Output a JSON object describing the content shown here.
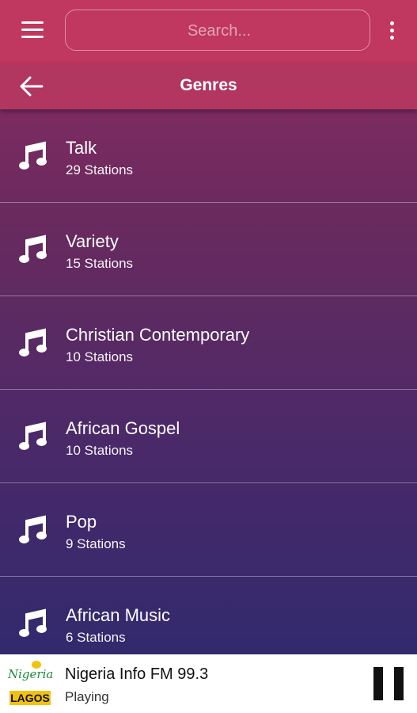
{
  "header": {
    "search_placeholder": "Search...",
    "title": "Genres",
    "menu_icon": "hamburger-menu-icon",
    "more_icon": "more-vertical-icon",
    "back_icon": "arrow-left-icon",
    "bar_color": "#c0375f"
  },
  "genres": [
    {
      "name": "Talk",
      "count": "29 Stations",
      "icon": "music-note-icon"
    },
    {
      "name": "Variety",
      "count": "15 Stations",
      "icon": "music-note-icon"
    },
    {
      "name": "Christian Contemporary",
      "count": "10 Stations",
      "icon": "music-note-icon"
    },
    {
      "name": "African Gospel",
      "count": "10 Stations",
      "icon": "music-note-icon"
    },
    {
      "name": "Pop",
      "count": "9 Stations",
      "icon": "music-note-icon"
    },
    {
      "name": "African Music",
      "count": "6 Stations",
      "icon": "music-note-icon"
    }
  ],
  "player": {
    "logo_text": "Nigeria",
    "logo_badge": "LAGOS",
    "station_name": "Nigeria Info FM 99.3",
    "status": "Playing",
    "pause_icon": "pause-icon"
  }
}
